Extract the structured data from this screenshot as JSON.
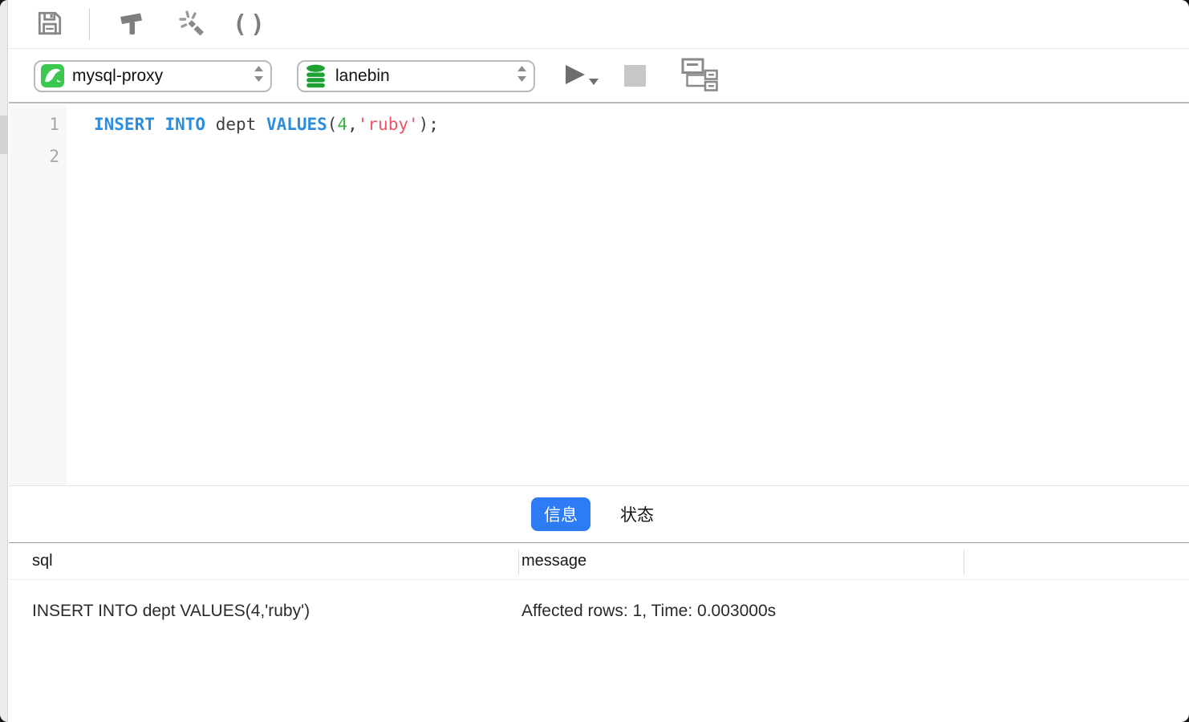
{
  "colors": {
    "accent": "#2e7cf5",
    "syntax_keyword": "#2b8ddd",
    "syntax_number": "#3cae4a",
    "syntax_string": "#ec5565",
    "mysql_icon_green": "#3cc84e",
    "database_icon_green": "#1ea233",
    "toolbar_icon_gray": "#868686"
  },
  "toolbar": {
    "icons": [
      "save-icon",
      "hammer-icon",
      "magic-wand-icon",
      "code-brackets-icon"
    ],
    "paren_glyph": "()"
  },
  "query_bar": {
    "connection_value": "mysql-proxy",
    "connection_icon": "mysql-icon",
    "database_value": "lanebin",
    "database_icon": "database-cylinder-icon",
    "run_icon": "play-icon",
    "stop_icon": "stop-square-icon",
    "stop_disabled": true,
    "explain_icon": "explain-plan-icon"
  },
  "editor": {
    "lines": [
      {
        "number": "1",
        "tokens": [
          {
            "t": "INSERT INTO",
            "c": "keyword"
          },
          {
            "t": " dept ",
            "c": "plain"
          },
          {
            "t": "VALUES",
            "c": "keyword"
          },
          {
            "t": "(",
            "c": "plain"
          },
          {
            "t": "4",
            "c": "number"
          },
          {
            "t": ",",
            "c": "plain"
          },
          {
            "t": "'ruby'",
            "c": "string"
          },
          {
            "t": ");",
            "c": "plain"
          }
        ]
      },
      {
        "number": "2",
        "tokens": []
      }
    ]
  },
  "tabs": [
    {
      "label": "信息",
      "active": true
    },
    {
      "label": "状态",
      "active": false
    }
  ],
  "results": {
    "columns": [
      "sql",
      "message"
    ],
    "rows": [
      [
        "INSERT INTO dept VALUES(4,'ruby')",
        "Affected rows: 1, Time: 0.003000s"
      ]
    ]
  }
}
